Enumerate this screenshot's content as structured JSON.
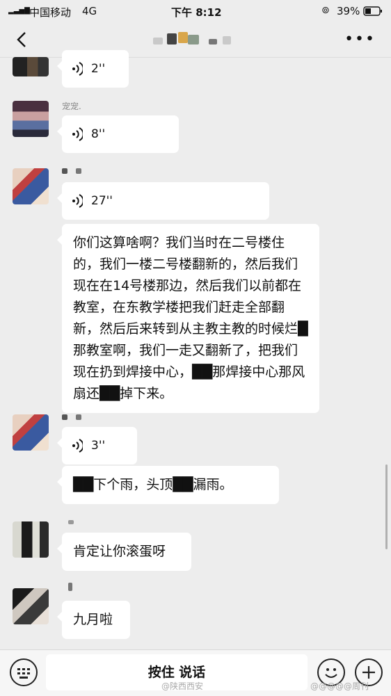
{
  "status": {
    "carrier": "中国移动",
    "network": "4G",
    "time": "下午 8:12",
    "battery": "39%"
  },
  "nav": {
    "more": "•••"
  },
  "messages": {
    "m1": {
      "duration": "2''"
    },
    "m2": {
      "sender": "宠宠.",
      "duration": "8''"
    },
    "m3": {
      "duration": "27''"
    },
    "m4": {
      "text": "你们这算啥啊？我们当时在二号楼住的，我们一楼二号楼翻新的，然后我们现在在14号楼那边，然后我们以前都在教室，在东教学楼把我们赶走全部翻新，然后后来转到从主教主教的时候烂█那教室啊，我们一走又翻新了，把我们现在扔到焊接中心，██那焊接中心那风扇还██掉下来。"
    },
    "m5": {
      "duration": "3''"
    },
    "m6": {
      "text": "██下个雨，头顶██漏雨。"
    },
    "m7": {
      "text": "肯定让你滚蛋呀"
    },
    "m8": {
      "text": "九月啦"
    }
  },
  "bottom": {
    "talk_label": "按住 说话"
  },
  "watermarks": {
    "left": "@陕西西安",
    "right": "@@@@@周刊"
  }
}
